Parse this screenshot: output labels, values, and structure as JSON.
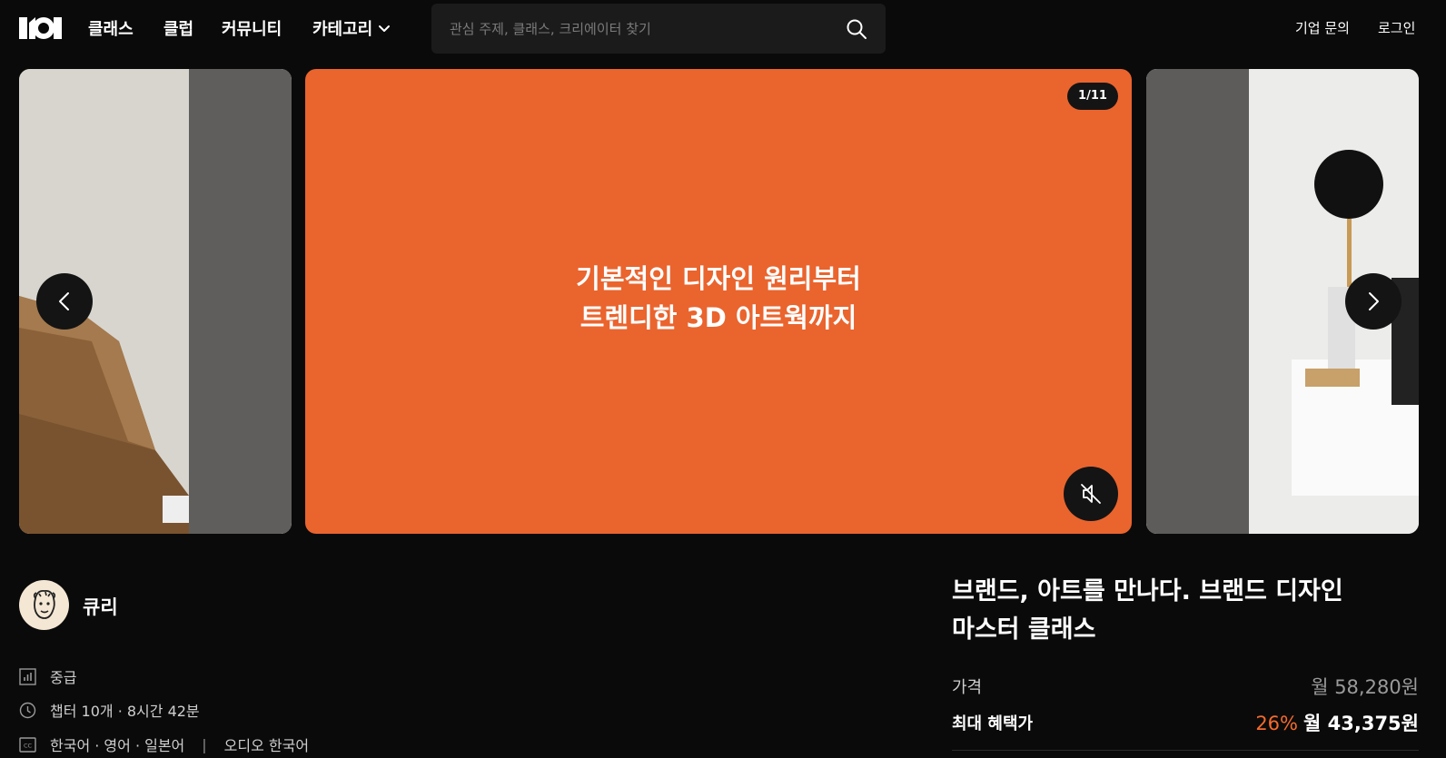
{
  "header": {
    "logo_alt": "101",
    "nav": [
      "클래스",
      "클럽",
      "커뮤니티"
    ],
    "category_label": "카테고리",
    "search_placeholder": "관심 주제, 클래스, 크리에이터 찾기",
    "enterprise_link": "기업 문의",
    "login_link": "로그인"
  },
  "carousel": {
    "headline_line1": "기본적인 디자인 원리부터",
    "headline_line2": "트렌디한 3D 아트웍까지",
    "counter": "1/11",
    "main_color": "#ea642e"
  },
  "creator": {
    "name": "큐리"
  },
  "info": {
    "level": "중급",
    "chapters": "챕터 10개 · 8시간 42분",
    "subtitles": "한국어 · 영어 · 일본어",
    "divider": "|",
    "audio": "오디오 한국어"
  },
  "course": {
    "title_line1": "브랜드, 아트를 만나다. 브랜드 디자인",
    "title_line2": "마스터 클래스",
    "price_label": "가격",
    "price_value": "월 58,280원",
    "benefit_label": "최대 혜택가",
    "discount": "26%",
    "benefit_value": "월 43,375원",
    "accent_color": "#f56a2d"
  }
}
